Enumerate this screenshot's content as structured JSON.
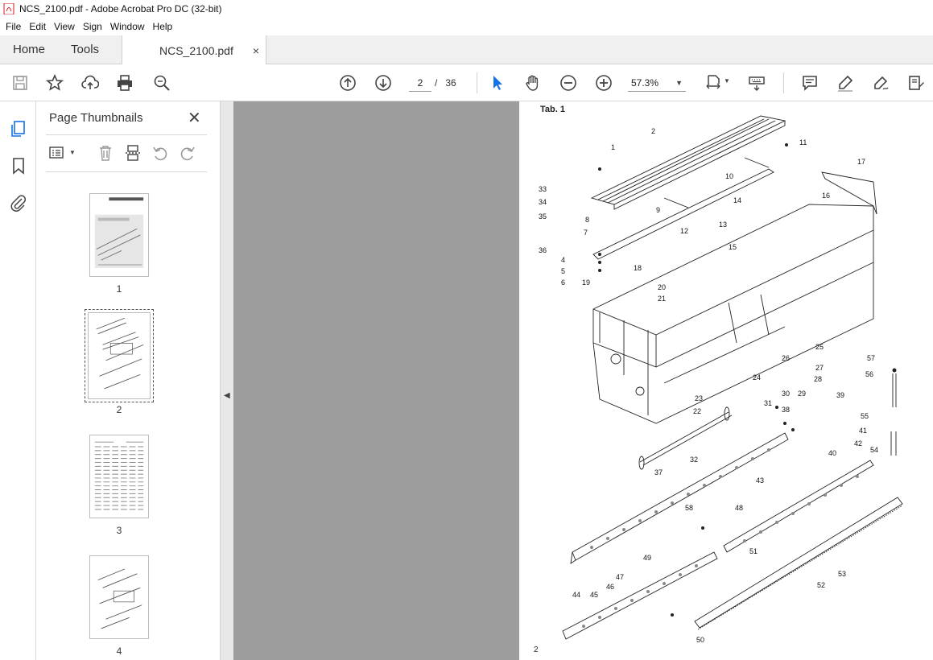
{
  "window": {
    "title": "NCS_2100.pdf - Adobe Acrobat Pro DC (32-bit)"
  },
  "menu": [
    "File",
    "Edit",
    "View",
    "Sign",
    "Window",
    "Help"
  ],
  "tabs": {
    "home": "Home",
    "tools": "Tools",
    "document": "NCS_2100.pdf",
    "close": "×"
  },
  "toolbar": {
    "current_page": "2",
    "page_separator": "/",
    "total_pages": "36",
    "zoom": "57.3%"
  },
  "panel": {
    "title": "Page Thumbnails",
    "close": "✕",
    "thumbnails": [
      {
        "label": "1"
      },
      {
        "label": "2"
      },
      {
        "label": "3"
      },
      {
        "label": "4"
      }
    ]
  },
  "page": {
    "heading": "Tab. 1",
    "footer_number": "2",
    "callouts": [
      "1",
      "2",
      "4",
      "5",
      "6",
      "7",
      "8",
      "9",
      "10",
      "11",
      "12",
      "13",
      "14",
      "15",
      "16",
      "17",
      "18",
      "19",
      "20",
      "21",
      "22",
      "23",
      "24",
      "25",
      "26",
      "27",
      "28",
      "29",
      "30",
      "31",
      "32",
      "33",
      "34",
      "35",
      "36",
      "37",
      "38",
      "39",
      "40",
      "41",
      "42",
      "43",
      "44",
      "45",
      "46",
      "47",
      "48",
      "49",
      "50",
      "51",
      "52",
      "53",
      "54",
      "55",
      "56",
      "57",
      "58"
    ]
  },
  "colors": {
    "accent": "#1473e6",
    "pdf_red": "#d7191c",
    "workspace": "#9d9d9d"
  }
}
